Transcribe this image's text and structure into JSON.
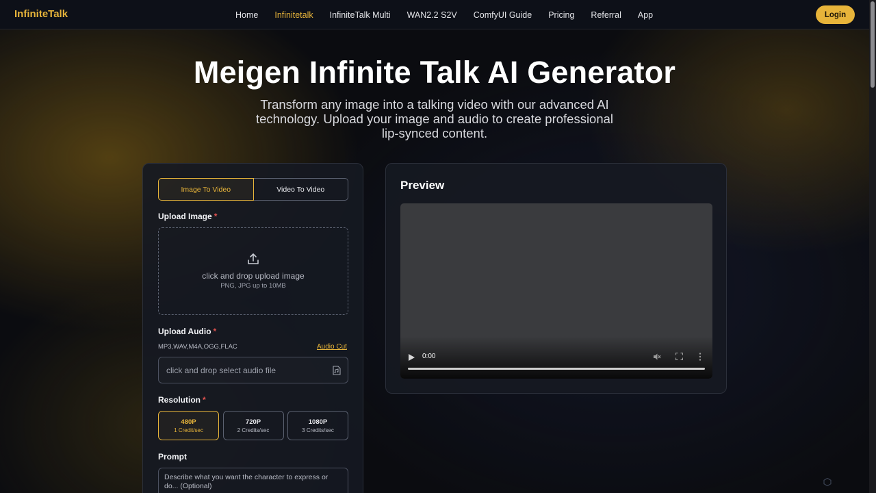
{
  "nav": {
    "logo": "InfiniteTalk",
    "links": [
      "Home",
      "Infinitetalk",
      "InfiniteTalk Multi",
      "WAN2.2 S2V",
      "ComfyUI Guide",
      "Pricing",
      "Referral",
      "App"
    ],
    "active_link": "Infinitetalk",
    "login_label": "Login"
  },
  "hero": {
    "title": "Meigen Infinite Talk AI Generator",
    "subtitle": "Transform any image into a talking video with our advanced AI technology. Upload your image and audio to create professional lip-synced content."
  },
  "generator": {
    "tabs": [
      "Image To Video",
      "Video To Video"
    ],
    "active_tab": "Image To Video",
    "upload_image": {
      "label": "Upload Image",
      "required_mark": "*",
      "text": "click and drop upload image",
      "hint": "PNG, JPG up to 10MB",
      "icon": "upload-icon"
    },
    "upload_audio": {
      "label": "Upload Audio",
      "required_mark": "*",
      "formats": "MP3,WAV,M4A,OGG,FLAC",
      "audio_cut": "Audio Cut",
      "placeholder": "click and drop select audio file",
      "icon": "audio-file-icon"
    },
    "resolution": {
      "label": "Resolution",
      "required_mark": "*",
      "options": [
        {
          "name": "480P",
          "credits": "1 Credit/sec"
        },
        {
          "name": "720P",
          "credits": "2 Credits/sec"
        },
        {
          "name": "1080P",
          "credits": "3 Credits/sec"
        }
      ],
      "selected": "480P"
    },
    "prompt": {
      "label": "Prompt",
      "placeholder": "Describe what you want the character to express or do... (Optional)"
    }
  },
  "preview": {
    "title": "Preview",
    "video": {
      "time": "0:00",
      "progress": 0.0
    }
  },
  "colors": {
    "accent": "#e7b43a",
    "background": "#0b0c10",
    "card": "#161922",
    "required": "#e0524f"
  }
}
